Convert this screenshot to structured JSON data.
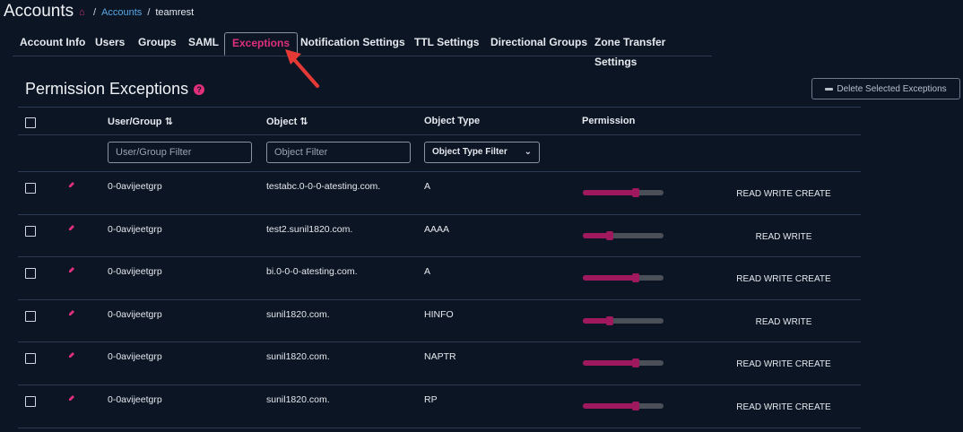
{
  "header": {
    "title": "Accounts",
    "breadcrumb": [
      {
        "label": "Accounts",
        "link": true
      },
      {
        "label": "teamrest",
        "link": false
      }
    ]
  },
  "tabs": [
    {
      "label": "Account Info",
      "active": false
    },
    {
      "label": "Users",
      "active": false
    },
    {
      "label": "Groups",
      "active": false
    },
    {
      "label": "SAML",
      "active": false
    },
    {
      "label": "Exceptions",
      "active": true
    },
    {
      "label": "Notification Settings",
      "active": false
    },
    {
      "label": "TTL Settings",
      "active": false
    },
    {
      "label": "Directional Groups",
      "active": false
    },
    {
      "label": "Zone Transfer Settings",
      "active": false
    }
  ],
  "section": {
    "title": "Permission Exceptions",
    "delete_label": "Delete Selected Exceptions"
  },
  "table": {
    "headers": {
      "user_group": "User/Group ⇅",
      "object": "Object ⇅",
      "object_type": "Object Type",
      "permission": "Permission"
    },
    "filters": {
      "user_group_placeholder": "User/Group Filter",
      "object_placeholder": "Object Filter",
      "object_type_label": "Object Type Filter"
    },
    "rows": [
      {
        "user_group": "0-0avijeetgrp",
        "object": "testabc.0-0-0-atesting.com.",
        "object_type": "A",
        "permission": "READ WRITE CREATE",
        "level": 0.66
      },
      {
        "user_group": "0-0avijeetgrp",
        "object": "test2.sunil1820.com.",
        "object_type": "AAAA",
        "permission": "READ WRITE",
        "level": 0.33
      },
      {
        "user_group": "0-0avijeetgrp",
        "object": "bi.0-0-0-atesting.com.",
        "object_type": "A",
        "permission": "READ WRITE CREATE",
        "level": 0.66
      },
      {
        "user_group": "0-0avijeetgrp",
        "object": "sunil1820.com.",
        "object_type": "HINFO",
        "permission": "READ WRITE",
        "level": 0.33
      },
      {
        "user_group": "0-0avijeetgrp",
        "object": "sunil1820.com.",
        "object_type": "NAPTR",
        "permission": "READ WRITE CREATE",
        "level": 0.66
      },
      {
        "user_group": "0-0avijeetgrp",
        "object": "sunil1820.com.",
        "object_type": "RP",
        "permission": "READ WRITE CREATE",
        "level": 0.66
      }
    ]
  },
  "colors": {
    "background": "#0b1524",
    "accent": "#e0307a",
    "slider_fill": "#a0195f",
    "slider_track": "#4a4f58",
    "link": "#5aa9e6"
  },
  "icons": [
    "home-icon",
    "help-icon",
    "minus-icon",
    "sort-icon",
    "pencil-icon",
    "chevron-down-icon",
    "arrow-annotation-icon"
  ]
}
